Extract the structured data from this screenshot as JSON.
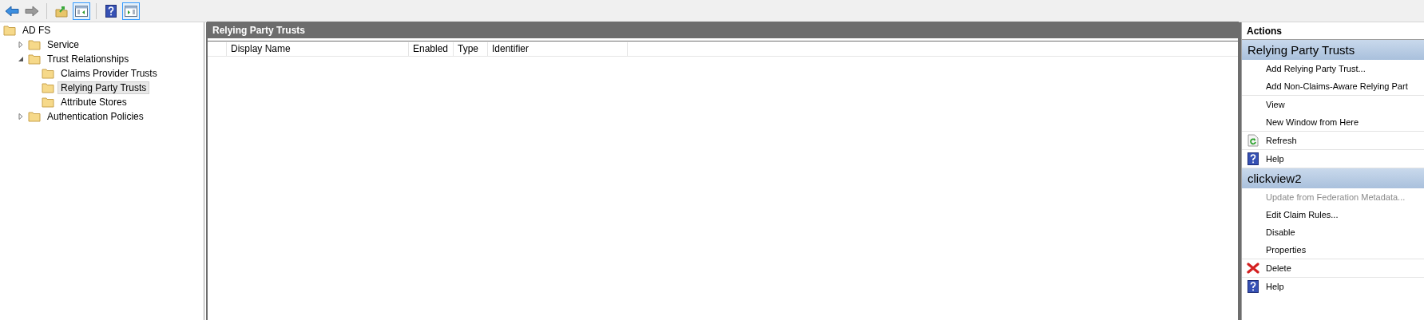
{
  "toolbar": [
    {
      "kind": "back",
      "disabled": false,
      "on": false
    },
    {
      "kind": "forward",
      "disabled": true,
      "on": false
    },
    {
      "kind": "up",
      "disabled": false,
      "on": false
    },
    {
      "kind": "tree",
      "disabled": false,
      "on": true
    },
    {
      "kind": "help",
      "disabled": false,
      "on": false
    },
    {
      "kind": "actions",
      "disabled": false,
      "on": true
    }
  ],
  "tree": [
    {
      "label": "AD FS",
      "selected": false,
      "children": [
        {
          "label": "Service",
          "expanded": false,
          "selected": false
        },
        {
          "label": "Trust Relationships",
          "expanded": true,
          "selected": false,
          "children": [
            {
              "label": "Claims Provider Trusts",
              "selected": false
            },
            {
              "label": "Relying Party Trusts",
              "selected": true
            },
            {
              "label": "Attribute Stores",
              "selected": false
            }
          ]
        },
        {
          "label": "Authentication Policies",
          "expanded": false,
          "selected": false
        }
      ]
    }
  ],
  "center": {
    "title": "Relying Party Trusts",
    "table": {
      "columns": [
        "Display Name",
        "Enabled",
        "Type",
        "Identifier"
      ]
    }
  },
  "actions": {
    "title": "Actions",
    "sections": [
      {
        "title": "Relying Party Trusts",
        "groups": [
          [
            {
              "label": "Add Relying Party Trust...",
              "kind": "plain",
              "disabled": false
            },
            {
              "label": "Add Non-Claims-Aware Relying Part",
              "kind": "plain",
              "disabled": false
            }
          ],
          [
            {
              "label": "View",
              "kind": "plain",
              "disabled": false
            },
            {
              "label": "New Window from Here",
              "kind": "plain",
              "disabled": false
            }
          ],
          [
            {
              "label": "Refresh",
              "kind": "refresh",
              "disabled": false
            }
          ],
          [
            {
              "label": "Help",
              "kind": "help",
              "disabled": false
            }
          ]
        ]
      },
      {
        "title": "clickview2",
        "groups": [
          [
            {
              "label": "Update from Federation Metadata...",
              "kind": "plain",
              "disabled": true
            },
            {
              "label": "Edit Claim Rules...",
              "kind": "plain",
              "disabled": false
            },
            {
              "label": "Disable",
              "kind": "plain",
              "disabled": false
            },
            {
              "label": "Properties",
              "kind": "plain",
              "disabled": false
            }
          ],
          [
            {
              "label": "Delete",
              "kind": "delete",
              "disabled": false
            }
          ],
          [
            {
              "label": "Help",
              "kind": "help",
              "disabled": false
            }
          ]
        ]
      }
    ]
  }
}
